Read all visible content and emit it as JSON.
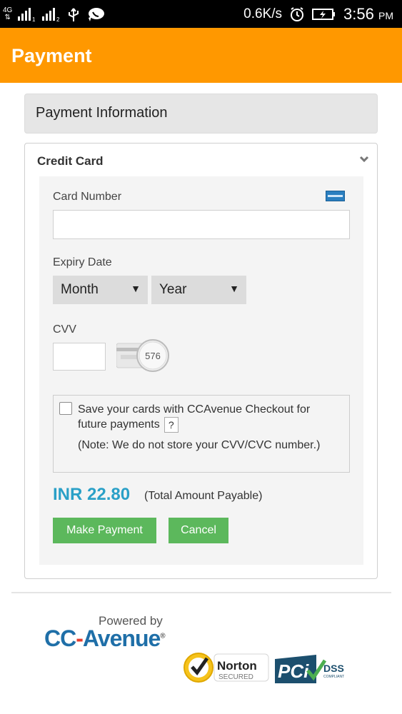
{
  "status_bar": {
    "network_type": "4G",
    "sim1_label": "1",
    "sim2_label": "2",
    "speed": "0.6K/s",
    "time": "3:56",
    "ampm": "PM"
  },
  "app_bar": {
    "title": "Payment"
  },
  "payment_info": {
    "title": "Payment Information"
  },
  "credit_card": {
    "title": "Credit Card",
    "card_number_label": "Card Number",
    "card_number_value": "",
    "expiry_label": "Expiry Date",
    "month_select": "Month",
    "year_select": "Year",
    "cvv_label": "CVV",
    "cvv_value": "",
    "cvv_hint_number": "576",
    "save_cards_text": "Save your cards with CCAvenue Checkout for future payments",
    "help_label": "?",
    "note_text": "(Note: We do not store your CVV/CVC number.)",
    "save_checked": false,
    "amount": "INR 22.80",
    "amount_note": "(Total Amount Payable)",
    "make_payment_label": "Make Payment",
    "cancel_label": "Cancel"
  },
  "footer": {
    "powered_by": "Powered by",
    "brand_cc": "CC",
    "brand_avenue": "Avenue",
    "registered": "®",
    "norton_label": "Norton",
    "norton_sub": "SECURED",
    "pci_label": "PCi",
    "pci_dss": "DSS",
    "pci_compliant": "COMPLIANT"
  },
  "colors": {
    "app_bar": "#ff9800",
    "amount": "#2aa0c7",
    "button": "#5cb85c",
    "brand_blue": "#1f6fa8",
    "brand_red": "#e63b2e"
  }
}
